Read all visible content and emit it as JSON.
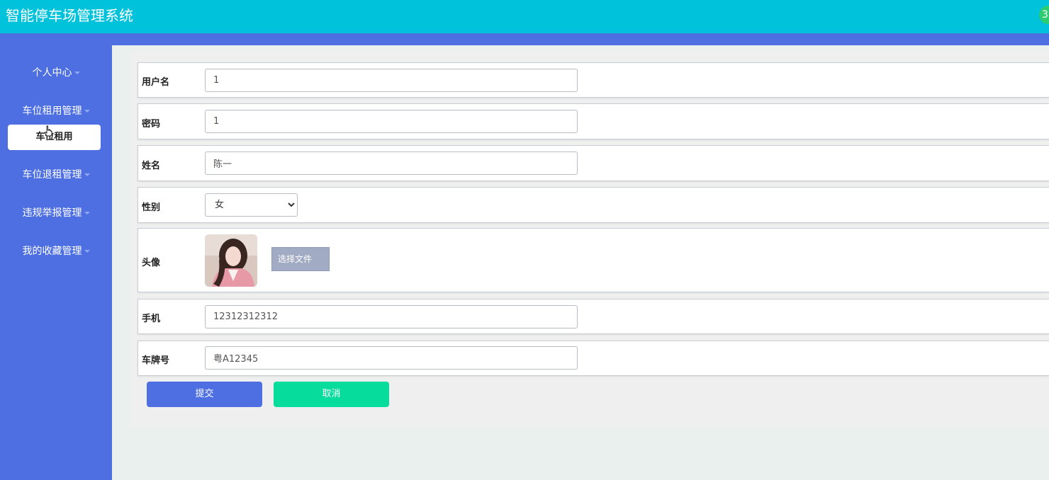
{
  "header": {
    "title": "智能停车场管理系统"
  },
  "sidebar": {
    "items": [
      {
        "label": "个人中心"
      },
      {
        "label": "车位租用管理"
      },
      {
        "label": "车位退租管理"
      },
      {
        "label": "违规举报管理"
      },
      {
        "label": "我的收藏管理"
      }
    ],
    "submenu": {
      "label": "车位租用"
    }
  },
  "form": {
    "username": {
      "label": "用户名",
      "value": "1"
    },
    "password": {
      "label": "密码",
      "value": "1"
    },
    "name": {
      "label": "姓名",
      "value": "陈一"
    },
    "gender": {
      "label": "性别",
      "value": "女"
    },
    "avatar": {
      "label": "头像",
      "button_label": "选择文件"
    },
    "phone": {
      "label": "手机",
      "value": "12312312312"
    },
    "plate": {
      "label": "车牌号",
      "value": "粤A12345"
    }
  },
  "actions": {
    "submit_label": "提交",
    "cancel_label": "取消"
  },
  "colors": {
    "header": "#00c2da",
    "sidebar": "#4e6fe1",
    "submit": "#4e6fe1",
    "cancel": "#06dc9c",
    "file_button": "#a1abc3"
  },
  "icons": {
    "header_corner": "status-icon",
    "cursor": "hand-pointer-icon"
  }
}
